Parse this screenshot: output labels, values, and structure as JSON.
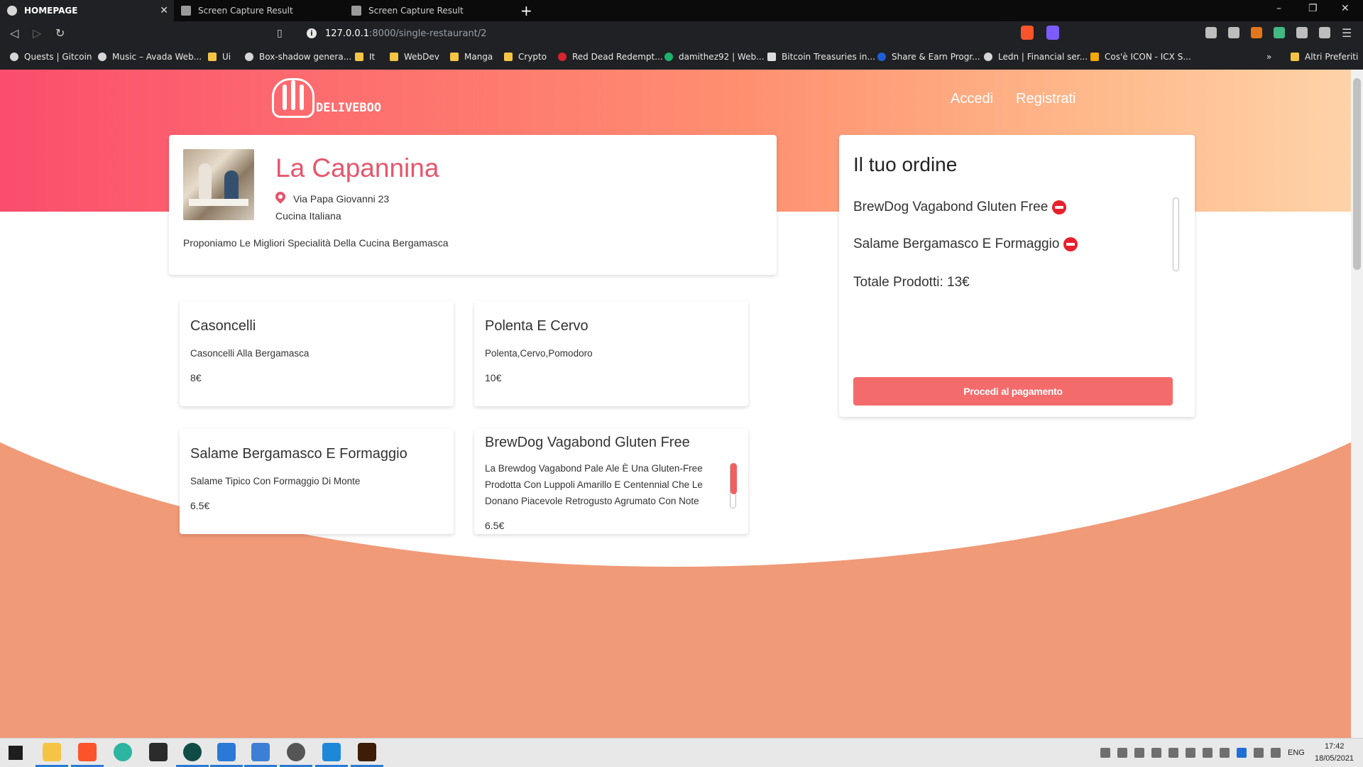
{
  "browser": {
    "tabs": [
      {
        "label": "HOMEPAGE",
        "active": true
      },
      {
        "label": "Screen Capture Result",
        "active": false
      },
      {
        "label": "Screen Capture Result",
        "active": false
      }
    ],
    "new_tab": "+",
    "url_host": "127.0.0.1",
    "url_path": ":8000/single-restaurant/2",
    "window_controls": [
      "–",
      "❐",
      "✕"
    ],
    "bookmarks": [
      "Quests | Gitcoin",
      "Music – Avada Web...",
      "Ui",
      "Box-shadow genera...",
      "It",
      "WebDev",
      "Manga",
      "Crypto",
      "Red Dead Redempt...",
      "damithez92 | Web...",
      "Bitcoin Treasuries in...",
      "Share & Earn Progr...",
      "Ledn | Financial ser...",
      "Cos'è ICON - ICX S..."
    ],
    "bookmarks_more": "»",
    "other_bookmarks": "Altri Preferiti"
  },
  "header": {
    "logo_text": "DELIVEBOO",
    "nav": [
      "Accedi",
      "Registrati"
    ]
  },
  "restaurant": {
    "name": "La Capannina",
    "address": "Via Papa Giovanni 23",
    "cuisine": "Cucina Italiana",
    "description": "Proponiamo Le Migliori Specialità Della Cucina Bergamasca"
  },
  "dishes": [
    {
      "name": "Casoncelli",
      "description": "Casoncelli Alla Bergamasca",
      "price": "8€"
    },
    {
      "name": "Polenta E Cervo",
      "description": "Polenta,Cervo,Pomodoro",
      "price": "10€"
    },
    {
      "name": "Salame Bergamasco E Formaggio",
      "description": "Salame Tipico Con Formaggio Di Monte",
      "price": "6.5€"
    },
    {
      "name": "BrewDog Vagabond Gluten Free",
      "description_lines": [
        "La Brewdog Vagabond Pale Ale È Una Gluten-Free",
        "Prodotta Con Luppoli Amarillo E Centennial Che Le",
        "Donano Piacevole Retrogusto Agrumato Con Note"
      ],
      "price": "6.5€"
    }
  ],
  "order": {
    "title": "Il tuo ordine",
    "items": [
      "BrewDog Vagabond Gluten Free",
      "Salame Bergamasco E Formaggio"
    ],
    "total": "Totale Prodotti: 13€",
    "pay_button": "Procedi al pagamento"
  },
  "taskbar": {
    "language": "ENG",
    "time": "17:42",
    "date": "18/05/2021"
  },
  "colors": {
    "accent": "#e5566c",
    "button": "#f46b6b",
    "remove": "#e8202d",
    "wave": "#f09a78"
  }
}
